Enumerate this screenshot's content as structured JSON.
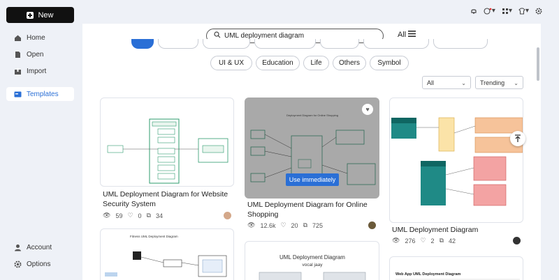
{
  "sidebar": {
    "new_label": "New",
    "items": [
      {
        "label": "Home",
        "icon": "home-icon"
      },
      {
        "label": "Open",
        "icon": "file-icon"
      },
      {
        "label": "Import",
        "icon": "import-icon"
      },
      {
        "label": "Templates",
        "icon": "templates-icon"
      },
      {
        "label": "Account",
        "icon": "user-icon"
      },
      {
        "label": "Options",
        "icon": "gear-icon"
      }
    ]
  },
  "search": {
    "value": "UML deployment diagram"
  },
  "all_menu_label": "All",
  "categories": [
    "UI & UX",
    "Education",
    "Life",
    "Others",
    "Symbol"
  ],
  "filters": {
    "type": "All",
    "sort": "Trending"
  },
  "cards": [
    {
      "title": "UML Deployment Diagram for Website Security System",
      "views": "59",
      "likes": "0",
      "copies": "34"
    },
    {
      "title": "UML Deployment Diagram for Online Shopping",
      "views": "12.6k",
      "likes": "20",
      "copies": "725",
      "hover_button": "Use immediately",
      "thumb_title": "Deployment Diagram for Online Shopping"
    },
    {
      "title": "UML Deployment Diagram",
      "views": "276",
      "likes": "2",
      "copies": "42"
    },
    {
      "title": "",
      "thumb_title": "Fitness UML Deployment Diagram"
    },
    {
      "title": "",
      "thumb_title": "UML Deployment Diagram",
      "thumb_subtitle": "vocal jaay"
    },
    {
      "title": "",
      "thumb_title": "Web App UML Deployment Diagram"
    }
  ],
  "colors": {
    "accent": "#2a6fd6",
    "new_button": "#111111"
  }
}
